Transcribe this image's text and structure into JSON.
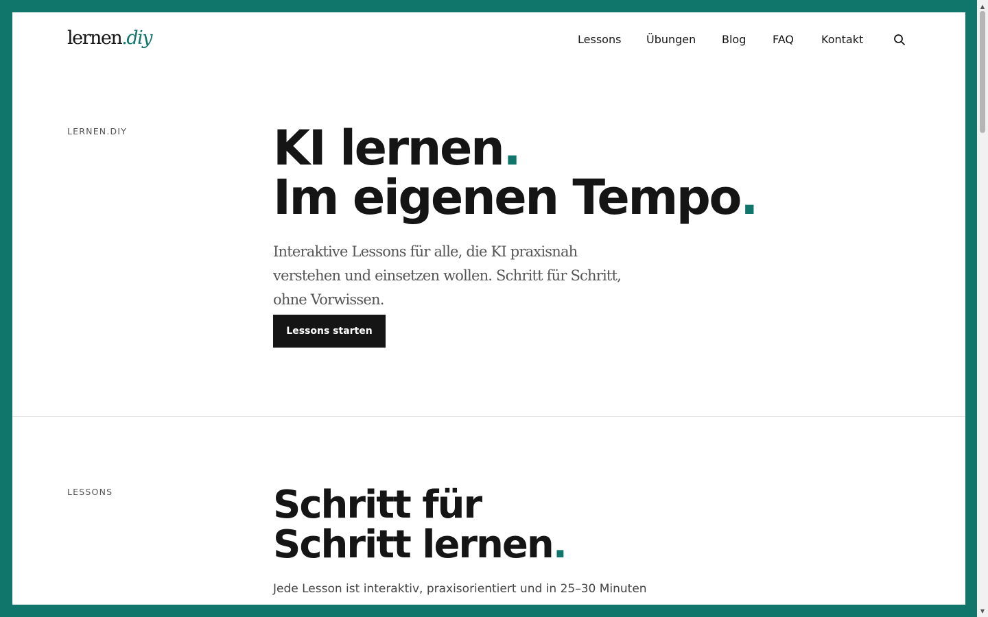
{
  "brand": {
    "name_main": "lernen",
    "name_accent": ".diy"
  },
  "nav": {
    "items": [
      {
        "label": "Lessons"
      },
      {
        "label": "Übungen"
      },
      {
        "label": "Blog"
      },
      {
        "label": "FAQ"
      },
      {
        "label": "Kontakt"
      }
    ],
    "search_icon": "search-icon"
  },
  "hero": {
    "label": "LERNEN.DIY",
    "title_line1": "KI lernen",
    "title_line2": "Im eigenen Tempo",
    "dot": ".",
    "subtitle": "Interaktive Lessons für alle, die KI praxisnah verstehen und einsetzen wollen. Schritt für Schritt, ohne Vorwissen.",
    "cta_label": "Lessons starten"
  },
  "lessons_section": {
    "label": "LESSONS",
    "title_line1": "Schritt für",
    "title_line2": "Schritt lernen",
    "dot": ".",
    "subtitle": "Jede Lesson ist interaktiv, praxisorientiert und in 25–30 Minuten"
  },
  "colors": {
    "accent": "#10766c",
    "text": "#151515",
    "button_bg": "#151515"
  }
}
